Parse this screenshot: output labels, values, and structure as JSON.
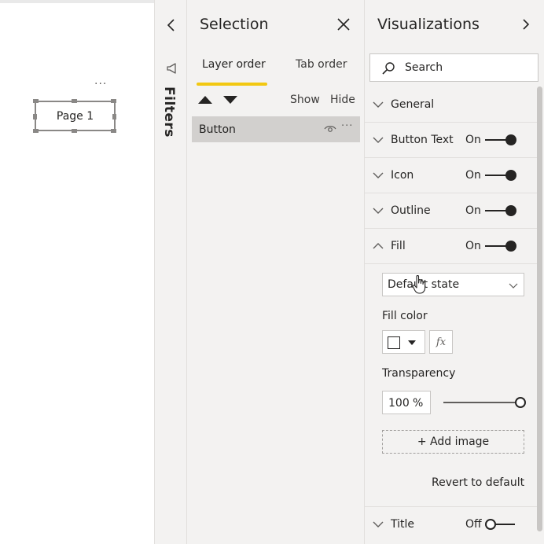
{
  "canvas": {
    "more_label": "···",
    "page_button_label": "Page 1"
  },
  "filters": {
    "label": "Filters",
    "collapse_icon": "chevron-left-icon",
    "megaphone_icon": "megaphone-icon"
  },
  "selection": {
    "title": "Selection",
    "tabs": [
      {
        "label": "Layer order",
        "active": true
      },
      {
        "label": "Tab order",
        "active": false
      }
    ],
    "show_label": "Show",
    "hide_label": "Hide",
    "layers": [
      {
        "name": "Button",
        "more_label": "···"
      }
    ],
    "accent_color": "#f2c811"
  },
  "visualizations": {
    "title": "Visualizations",
    "search_placeholder": "Search",
    "cards": [
      {
        "label": "General",
        "expanded": false,
        "toggle": null
      },
      {
        "label": "Button Text",
        "expanded": false,
        "toggle": "On"
      },
      {
        "label": "Icon",
        "expanded": false,
        "toggle": "On"
      },
      {
        "label": "Outline",
        "expanded": false,
        "toggle": "On"
      },
      {
        "label": "Fill",
        "expanded": true,
        "toggle": "On"
      }
    ],
    "fill": {
      "state_value": "Default state",
      "fill_color_label": "Fill color",
      "fx_label": "fx",
      "transparency_label": "Transparency",
      "transparency_value": "100",
      "transparency_unit": "%",
      "transparency_slider_fraction": 1.0,
      "add_image_label": "+ Add image",
      "revert_label": "Revert to default"
    },
    "title_card": {
      "label": "Title",
      "toggle": "Off"
    }
  }
}
